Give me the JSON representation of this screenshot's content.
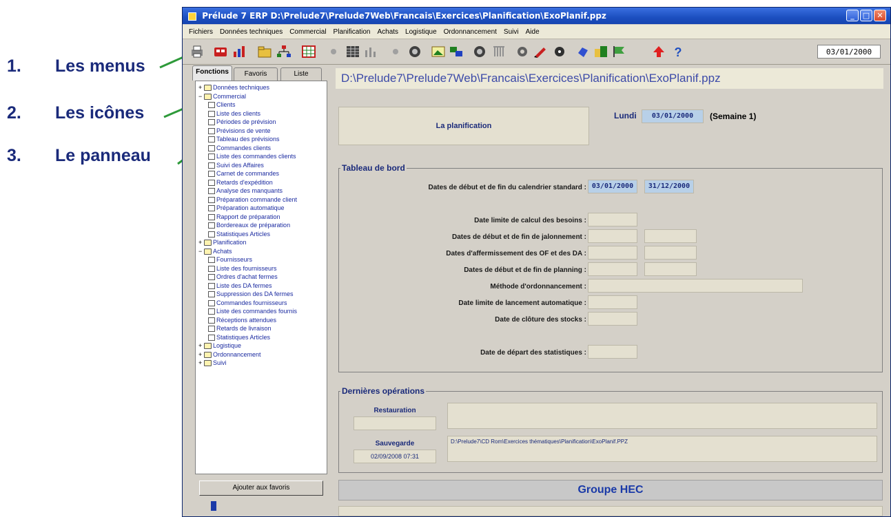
{
  "annotations": [
    {
      "num": "1.",
      "text": "Les menus"
    },
    {
      "num": "2.",
      "text": "Les icônes"
    },
    {
      "num": "3.",
      "text": "Le panneau"
    }
  ],
  "window": {
    "title": "Prélude 7 ERP  D:\\Prelude7\\Prelude7Web\\Francais\\Exercices\\Planification\\ExoPlanif.ppz"
  },
  "menus": [
    "Fichiers",
    "Données techniques",
    "Commercial",
    "Planification",
    "Achats",
    "Logistique",
    "Ordonnancement",
    "Suivi",
    "Aide"
  ],
  "toolbar": {
    "date": "03/01/2000",
    "icons": [
      "print-icon",
      "red-tool-icon",
      "chart-tool-icon",
      "folder-tool-icon",
      "tree-structure-icon",
      "grid-tool-icon",
      "dot-icon",
      "table-icon",
      "bar-chart-icon",
      "dot-icon",
      "target-icon",
      "image-icon",
      "transfer-icon",
      "target-icon",
      "comb-icon",
      "gear-icon",
      "pencil-icon",
      "record-icon",
      "hand-icon",
      "building-icon",
      "flag-icon",
      "up-arrow-icon",
      "help-icon"
    ]
  },
  "left_panel": {
    "tabs": [
      "Fonctions",
      "Favoris",
      "Liste"
    ],
    "tree": [
      {
        "level": 0,
        "type": "folder",
        "exp": "+",
        "label": "Données techniques"
      },
      {
        "level": 0,
        "type": "folder",
        "exp": "−",
        "label": "Commercial"
      },
      {
        "level": 1,
        "type": "item",
        "label": "Clients"
      },
      {
        "level": 1,
        "type": "item",
        "label": "Liste des clients"
      },
      {
        "level": 1,
        "type": "item",
        "label": "Périodes de prévision"
      },
      {
        "level": 1,
        "type": "item",
        "label": "Prévisions de vente"
      },
      {
        "level": 1,
        "type": "item",
        "label": "Tableau des prévisions"
      },
      {
        "level": 1,
        "type": "item",
        "label": "Commandes clients"
      },
      {
        "level": 1,
        "type": "item",
        "label": "Liste des commandes clients"
      },
      {
        "level": 1,
        "type": "item",
        "label": "Suivi des Affaires"
      },
      {
        "level": 1,
        "type": "item",
        "label": "Carnet de commandes"
      },
      {
        "level": 1,
        "type": "item",
        "label": "Retards d'expédition"
      },
      {
        "level": 1,
        "type": "item",
        "label": "Analyse des manquants"
      },
      {
        "level": 1,
        "type": "item",
        "label": "Préparation commande client"
      },
      {
        "level": 1,
        "type": "item",
        "label": "Préparation automatique"
      },
      {
        "level": 1,
        "type": "item",
        "label": "Rapport de préparation"
      },
      {
        "level": 1,
        "type": "item",
        "label": "Bordereaux de préparation"
      },
      {
        "level": 1,
        "type": "item",
        "label": "Statistiques Articles"
      },
      {
        "level": 0,
        "type": "folder",
        "exp": "+",
        "label": "Planification"
      },
      {
        "level": 0,
        "type": "folder",
        "exp": "−",
        "label": "Achats"
      },
      {
        "level": 1,
        "type": "item",
        "label": "Fournisseurs"
      },
      {
        "level": 1,
        "type": "item",
        "label": "Liste des fournisseurs"
      },
      {
        "level": 1,
        "type": "item",
        "label": "Ordres d'achat fermes"
      },
      {
        "level": 1,
        "type": "item",
        "label": "Liste des DA fermes"
      },
      {
        "level": 1,
        "type": "item",
        "label": "Suppression des DA fermes"
      },
      {
        "level": 1,
        "type": "item",
        "label": "Commandes fournisseurs"
      },
      {
        "level": 1,
        "type": "item",
        "label": "Liste des commandes fournis"
      },
      {
        "level": 1,
        "type": "item",
        "label": "Réceptions attendues"
      },
      {
        "level": 1,
        "type": "item",
        "label": "Retards de livraison"
      },
      {
        "level": 1,
        "type": "item",
        "label": "Statistiques Articles"
      },
      {
        "level": 0,
        "type": "folder",
        "exp": "+",
        "label": "Logistique"
      },
      {
        "level": 0,
        "type": "folder",
        "exp": "+",
        "label": "Ordonnancement"
      },
      {
        "level": 0,
        "type": "folder",
        "exp": "+",
        "label": "Suivi"
      }
    ],
    "favorites_button": "Ajouter aux favoris"
  },
  "main": {
    "path": "D:\\Prelude7\\Prelude7Web\\Francais\\Exercices\\Planification\\ExoPlanif.ppz",
    "planning_title": "La planification",
    "day_label": "Lundi",
    "day_date": "03/01/2000",
    "week_label": "(Semaine 1)",
    "dashboard": {
      "legend": "Tableau de bord",
      "std_calendar_label": "Dates de début et de fin du calendrier standard :",
      "std_calendar_start": "03/01/2000",
      "std_calendar_end": "31/12/2000",
      "needs_limit_label": "Date limite de calcul des besoins :",
      "milestone_label": "Dates de début et de fin de jalonnement :",
      "firming_label": "Dates d'affermissement des OF et des DA :",
      "planning_dates_label": "Dates de début et de fin de planning :",
      "scheduling_method_label": "Méthode d'ordonnancement :",
      "auto_launch_label": "Date limite de lancement automatique :",
      "stock_close_label": "Date de clôture des stocks :",
      "stats_start_label": "Date de départ des statistiques :"
    },
    "operations": {
      "legend": "Dernières opérations",
      "restore_label": "Restauration",
      "backup_label": "Sauvegarde",
      "backup_date": "02/09/2008 07:31",
      "backup_path": "D:\\Prelude7\\CD Rom\\Exercices thématiques\\Planification\\ExoPlanif.PPZ"
    },
    "footer": "Groupe HEC"
  }
}
